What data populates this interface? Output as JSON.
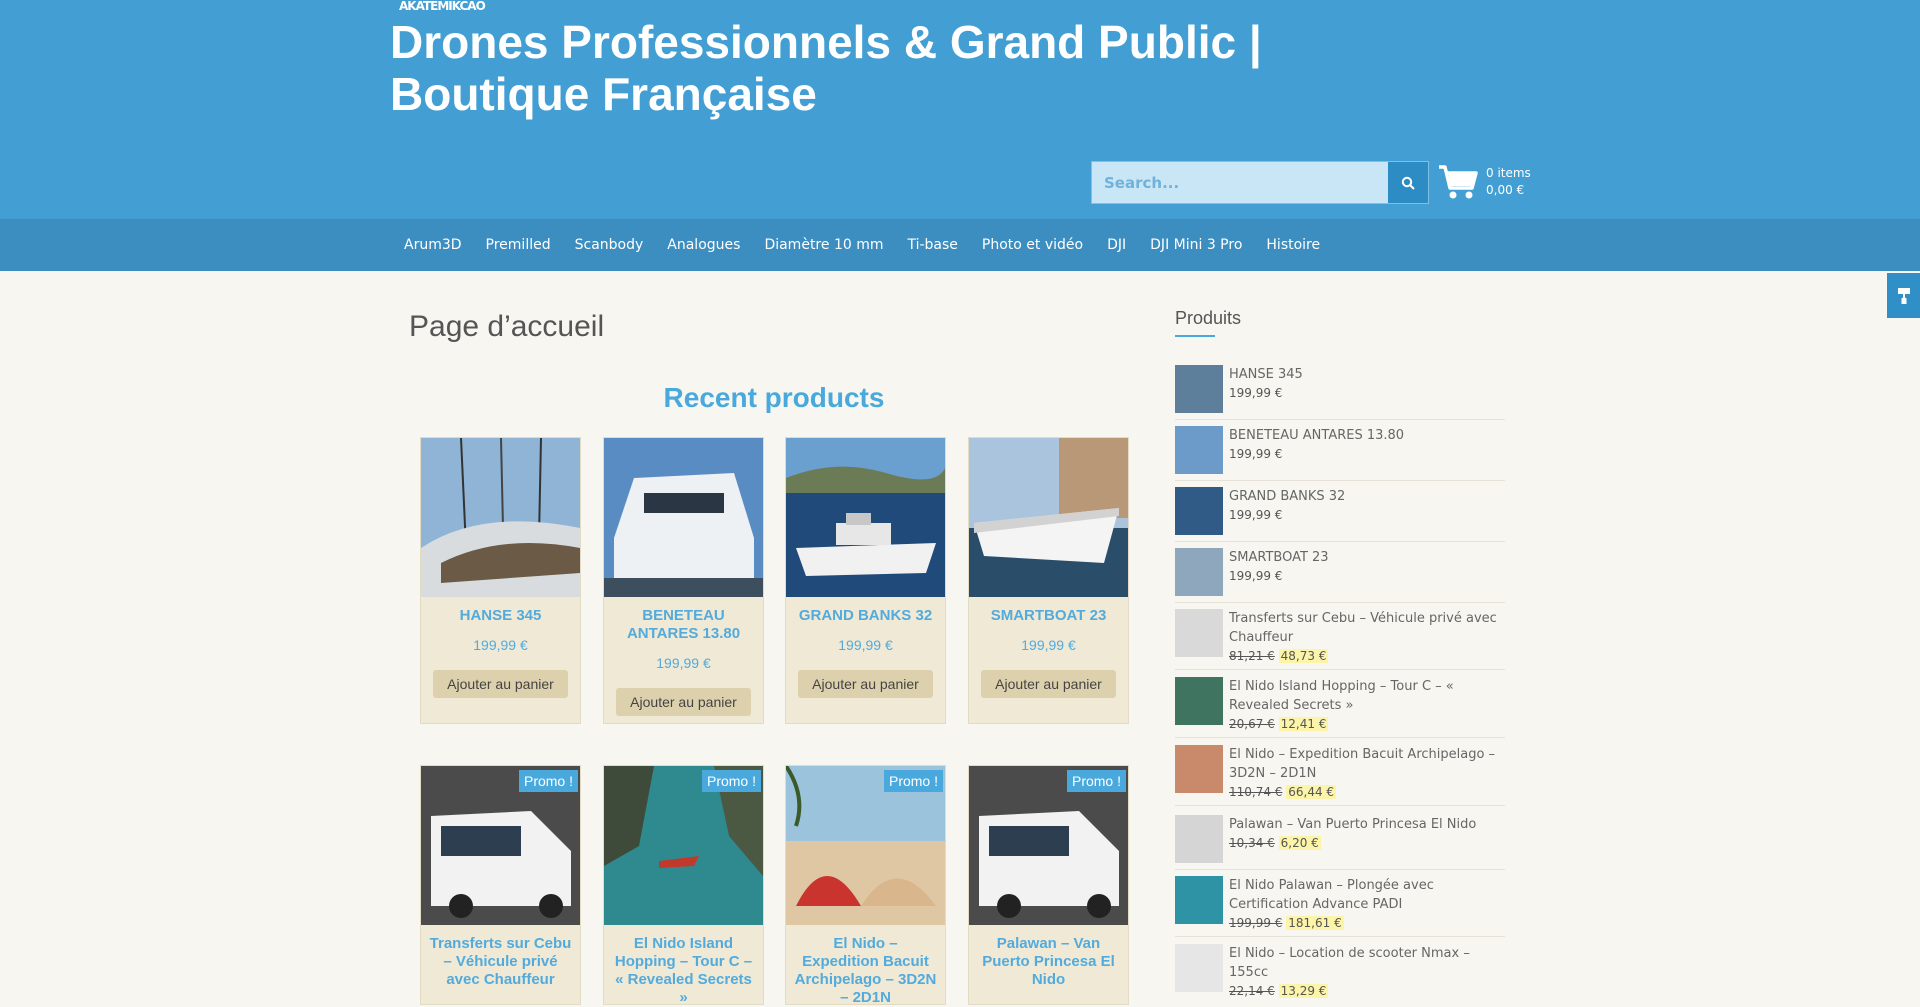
{
  "header": {
    "logo_text": "AKATEMIKCAO",
    "site_title": "Drones Professionnels & Grand Public | Boutique Française",
    "search_placeholder": "Search...",
    "cart_count": "0 items",
    "cart_total": "0,00 €"
  },
  "nav": [
    "Arum3D",
    "Premilled",
    "Scanbody",
    "Analogues",
    "Diamètre 10 mm",
    "Ti-base",
    "Photo et vidéo",
    "DJI",
    "DJI Mini 3 Pro",
    "Histoire"
  ],
  "main": {
    "page_title": "Page d’accueil",
    "recent_title": "Recent products",
    "add_to_cart": "Ajouter au panier",
    "promo_label": "Promo !",
    "products_row1": [
      {
        "name": "HANSE 345",
        "price": "199,99 €"
      },
      {
        "name": "BENETEAU ANTARES 13.80",
        "price": "199,99 €"
      },
      {
        "name": "GRAND BANKS 32",
        "price": "199,99 €"
      },
      {
        "name": "SMARTBOAT 23",
        "price": "199,99 €"
      }
    ],
    "products_row2": [
      {
        "name": "Transferts sur Cebu – Véhicule privé avec Chauffeur"
      },
      {
        "name": "El Nido Island Hopping – Tour C – « Revealed Secrets »"
      },
      {
        "name": "El Nido – Expedition Bacuit Archipelago – 3D2N – 2D1N"
      },
      {
        "name": "Palawan – Van Puerto Princesa El Nido"
      }
    ]
  },
  "sidebar": {
    "title": "Produits",
    "items": [
      {
        "name": "HANSE 345",
        "price": "199,99 €"
      },
      {
        "name": "BENETEAU ANTARES 13.80",
        "price": "199,99 €"
      },
      {
        "name": "GRAND BANKS 32",
        "price": "199,99 €"
      },
      {
        "name": "SMARTBOAT 23",
        "price": "199,99 €"
      },
      {
        "name": "Transferts sur Cebu – Véhicule privé avec Chauffeur",
        "old_price": "81,21 €",
        "new_price": "48,73 €"
      },
      {
        "name": "El Nido Island Hopping – Tour C – « Revealed Secrets »",
        "old_price": "20,67 €",
        "new_price": "12,41 €"
      },
      {
        "name": "El Nido – Expedition Bacuit Archipelago – 3D2N – 2D1N",
        "old_price": "110,74 €",
        "new_price": "66,44 €"
      },
      {
        "name": "Palawan – Van Puerto Princesa El Nido",
        "old_price": "10,34 €",
        "new_price": "6,20 €"
      },
      {
        "name": "El Nido Palawan – Plongée avec Certification Advance PADI",
        "old_price": "199,99 €",
        "new_price": "181,61 €"
      },
      {
        "name": "El Nido – Location de scooter Nmax – 155cc",
        "old_price": "22,14 €",
        "new_price": "13,29 €"
      }
    ]
  },
  "colors": {
    "header": "#439fd3",
    "nav": "#3d8ec0",
    "accent": "#4aa9dc",
    "background": "#f7f6f0"
  }
}
